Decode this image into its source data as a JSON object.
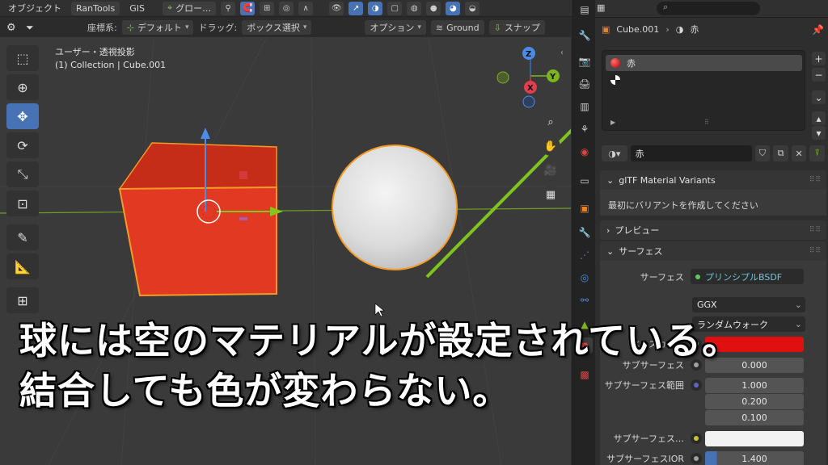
{
  "header": {
    "object_menu": "オブジェクト",
    "addon_menu": "RanTools",
    "gis_menu": "GIS",
    "orientation": "グロー…"
  },
  "subheader": {
    "coord_label": "座標系:",
    "coord_value": "デフォルト",
    "drag_label": "ドラッグ:",
    "drag_value": "ボックス選択",
    "options_label": "オプション",
    "ground_label": "Ground",
    "snap_label": "スナップ"
  },
  "viewport": {
    "view_name": "ユーザー・透視投影",
    "collection_info": "(1) Collection | Cube.001",
    "gizmo_axes": [
      "Z",
      "X",
      "Y"
    ],
    "colors": {
      "cube": "#e23a22",
      "cube_outline": "#f59a24",
      "sphere_outline": "#f59a24",
      "x_axis": "#b04a4a",
      "y_axis": "#7db31e",
      "annotation_arrow": "#7fc41f"
    }
  },
  "properties": {
    "object_name": "Cube.001",
    "material_crumb": "赤",
    "slots": [
      {
        "name": "赤"
      },
      {
        "name": ""
      }
    ],
    "material_name": "赤",
    "sections": {
      "variants_title": "glTF Material Variants",
      "variants_hint": "最初にバリアントを作成してください",
      "preview_title": "プレビュー",
      "surface_title": "サーフェス"
    },
    "surface": {
      "surface_label": "サーフェス",
      "surface_value": "プリンシプルBSDF",
      "distribution": "GGX",
      "sss_method": "ランダムウォーク",
      "base_color_label": "ベースカラー",
      "base_color": "#e01010",
      "subsurface_label": "サブサーフェス",
      "subsurface_value": "0.000",
      "radius_label": "サブサーフェス範囲",
      "radius_values": [
        "1.000",
        "0.200",
        "0.100"
      ],
      "sss_color_label": "サブサーフェス…",
      "ior_label": "サブサーフェスIOR",
      "ior_value": "1.400"
    }
  },
  "subtitle": {
    "line1": "球には空のマテリアルが設定されている。",
    "line2": "結合しても色が変わらない。"
  }
}
